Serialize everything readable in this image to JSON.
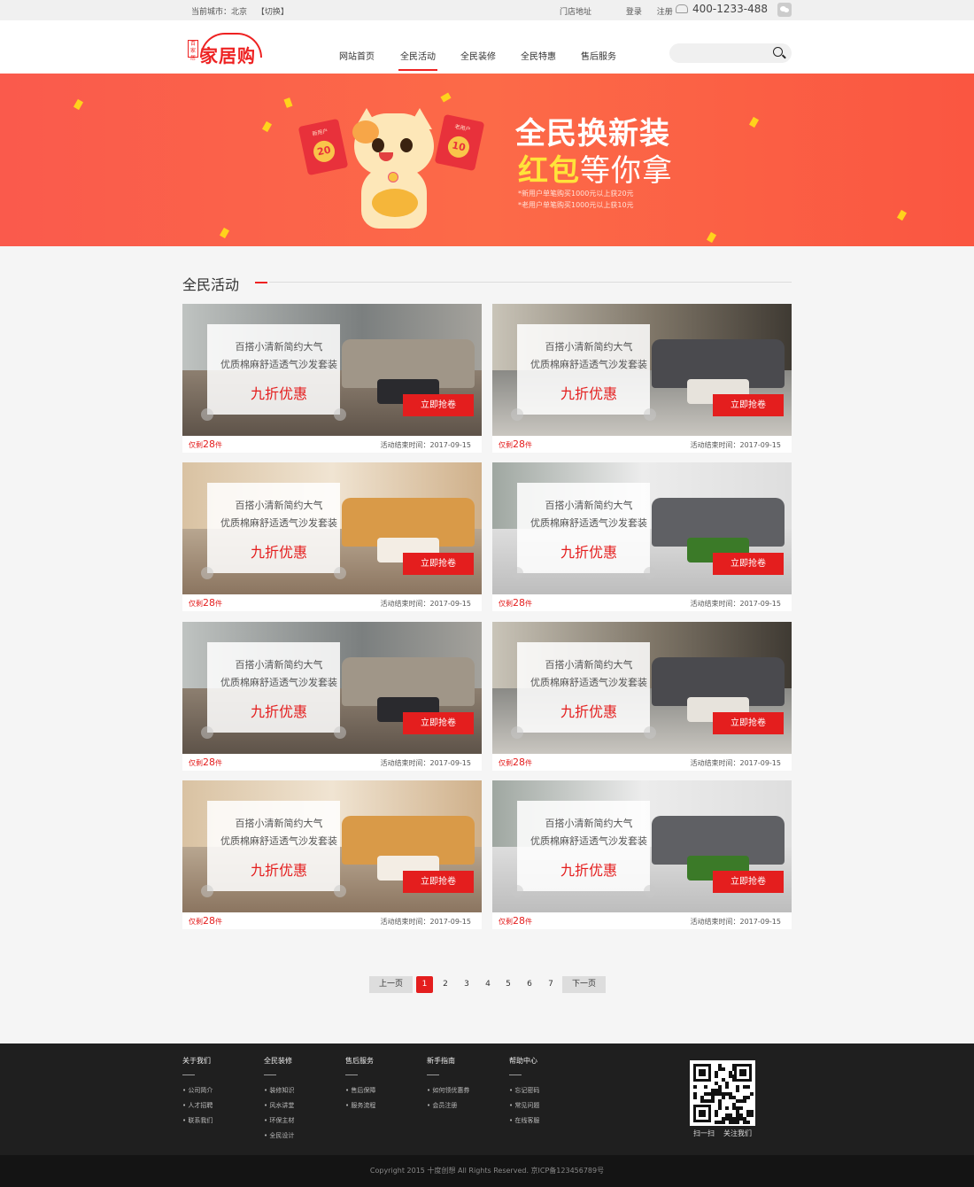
{
  "topbar": {
    "city_label": "当前城市：北京",
    "switch_label": "【切换】",
    "store": "门店地址",
    "login": "登录",
    "register": "注册",
    "phone": "400-1233-488"
  },
  "header": {
    "logo_seal": "百家居",
    "logo_text": "家居购",
    "nav": [
      "网站首页",
      "全民活动",
      "全民装修",
      "全民特惠",
      "售后服务"
    ],
    "active_nav": "全民活动",
    "search_placeholder": ""
  },
  "banner": {
    "title1": "全民换新装",
    "title2_highlight": "红包",
    "title2_rest": "等你拿",
    "note1": "*新用户单笔购买1000元以上获20元",
    "note2": "*老用户单笔购买1000元以上获10元",
    "envelope_left_label": "新用户",
    "envelope_left_value": "20",
    "envelope_right_label": "老用户",
    "envelope_right_value": "10"
  },
  "section": {
    "title": "全民活动"
  },
  "cards": [
    {
      "line1": "百搭小清新简约大气",
      "line2": "优质棉麻舒适透气沙发套装",
      "offer": "九折优惠",
      "button": "立即抢卷",
      "left_prefix": "仅剩",
      "left_num": "28",
      "left_suffix": "件",
      "end": "活动结束时间：2017-09-15",
      "scene": "sofa"
    },
    {
      "line1": "百搭小清新简约大气",
      "line2": "优质棉麻舒适透气沙发套装",
      "offer": "九折优惠",
      "button": "立即抢卷",
      "left_prefix": "仅剩",
      "left_num": "28",
      "left_suffix": "件",
      "end": "活动结束时间：2017-09-15",
      "scene": "bed-dark"
    },
    {
      "line1": "百搭小清新简约大气",
      "line2": "优质棉麻舒适透气沙发套装",
      "offer": "九折优惠",
      "button": "立即抢卷",
      "left_prefix": "仅剩",
      "left_num": "28",
      "left_suffix": "件",
      "end": "活动结束时间：2017-09-15",
      "scene": "bed-wood"
    },
    {
      "line1": "百搭小清新简约大气",
      "line2": "优质棉麻舒适透气沙发套装",
      "offer": "九折优惠",
      "button": "立即抢卷",
      "left_prefix": "仅剩",
      "left_num": "28",
      "left_suffix": "件",
      "end": "活动结束时间：2017-09-15",
      "scene": "sofa-grey"
    },
    {
      "line1": "百搭小清新简约大气",
      "line2": "优质棉麻舒适透气沙发套装",
      "offer": "九折优惠",
      "button": "立即抢卷",
      "left_prefix": "仅剩",
      "left_num": "28",
      "left_suffix": "件",
      "end": "活动结束时间：2017-09-15",
      "scene": "sofa"
    },
    {
      "line1": "百搭小清新简约大气",
      "line2": "优质棉麻舒适透气沙发套装",
      "offer": "九折优惠",
      "button": "立即抢卷",
      "left_prefix": "仅剩",
      "left_num": "28",
      "left_suffix": "件",
      "end": "活动结束时间：2017-09-15",
      "scene": "bed-dark"
    },
    {
      "line1": "百搭小清新简约大气",
      "line2": "优质棉麻舒适透气沙发套装",
      "offer": "九折优惠",
      "button": "立即抢卷",
      "left_prefix": "仅剩",
      "left_num": "28",
      "left_suffix": "件",
      "end": "活动结束时间：2017-09-15",
      "scene": "bed-wood"
    },
    {
      "line1": "百搭小清新简约大气",
      "line2": "优质棉麻舒适透气沙发套装",
      "offer": "九折优惠",
      "button": "立即抢卷",
      "left_prefix": "仅剩",
      "left_num": "28",
      "left_suffix": "件",
      "end": "活动结束时间：2017-09-15",
      "scene": "sofa-grey"
    }
  ],
  "pagination": {
    "prev": "上一页",
    "next": "下一页",
    "pages": [
      "1",
      "2",
      "3",
      "4",
      "5",
      "6",
      "7"
    ],
    "current": "1"
  },
  "footer": {
    "columns": [
      {
        "title": "关于我们",
        "items": [
          "• 公司简介",
          "• 人才招聘",
          "• 联系我们"
        ]
      },
      {
        "title": "全民装修",
        "items": [
          "• 装修知识",
          "• 风水讲堂",
          "• 环保主材",
          "• 全民设计"
        ]
      },
      {
        "title": "售后服务",
        "items": [
          "• 售后保障",
          "• 服务流程"
        ]
      },
      {
        "title": "新手指南",
        "items": [
          "• 如何领优惠券",
          "• 会员注册"
        ]
      },
      {
        "title": "帮助中心",
        "items": [
          "• 忘记密码",
          "• 常见问题",
          "• 在线客服"
        ]
      }
    ],
    "qr_scan": "扫一扫",
    "qr_follow": "关注我们",
    "copyright": "Copyright 2015 十度创想 All Rights Reserved. 京ICP备123456789号"
  },
  "colors": {
    "brand_red": "#e41e1e",
    "banner_orange": "#fa5a4c",
    "footer_dark": "#1f1f1f"
  },
  "icons": [
    "phone-icon",
    "wechat-icon",
    "search-icon"
  ]
}
